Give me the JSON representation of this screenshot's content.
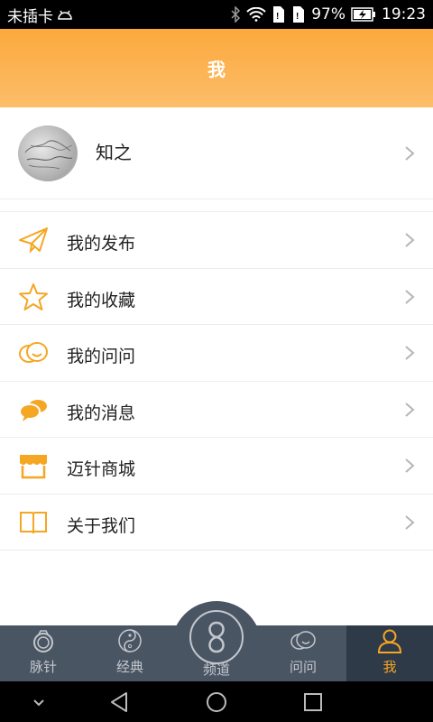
{
  "status_bar": {
    "carrier": "未插卡",
    "battery_percent": "97%",
    "time": "19:23"
  },
  "header": {
    "title": "我"
  },
  "profile": {
    "name": "知之"
  },
  "menu": {
    "items": [
      {
        "label": "我的发布",
        "icon": "paper-plane-icon"
      },
      {
        "label": "我的收藏",
        "icon": "star-icon"
      },
      {
        "label": "我的问问",
        "icon": "chat-bubbles-icon"
      },
      {
        "label": "我的消息",
        "icon": "message-bubbles-icon"
      },
      {
        "label": "迈针商城",
        "icon": "shop-icon"
      },
      {
        "label": "关于我们",
        "icon": "book-icon"
      }
    ]
  },
  "tabs": {
    "items": [
      {
        "label": "脉针",
        "icon": "ring-icon"
      },
      {
        "label": "经典",
        "icon": "yin-yang-icon"
      },
      {
        "label": "频道",
        "icon": "channel-logo-icon"
      },
      {
        "label": "问问",
        "icon": "chat-bubbles-icon"
      },
      {
        "label": "我",
        "icon": "person-icon"
      }
    ],
    "active": "我"
  },
  "colors": {
    "accent": "#f5a623",
    "header_top": "#fba93c",
    "tab_bar": "#4a5564",
    "tab_active_bg": "#2f3a49"
  }
}
